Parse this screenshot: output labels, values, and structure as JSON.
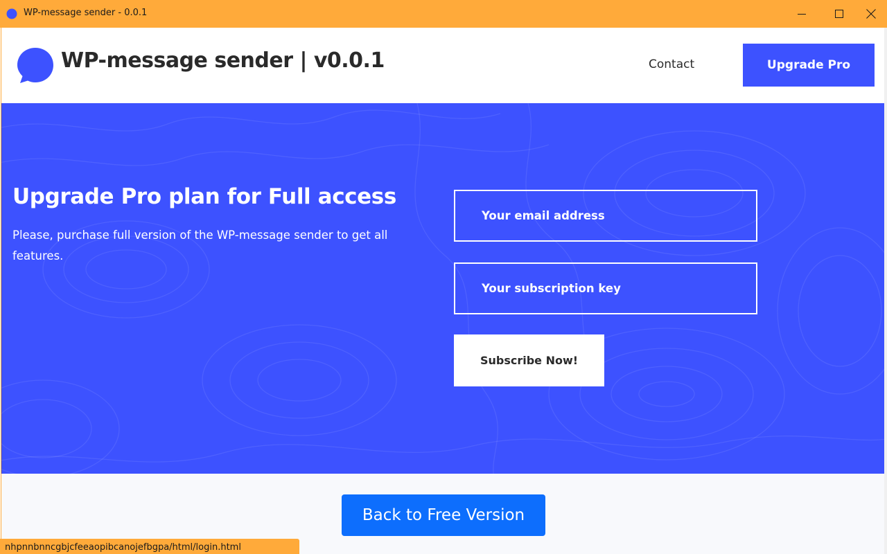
{
  "window": {
    "title": "WP-message sender - 0.0.1",
    "accent_color": "#ffaa3a"
  },
  "header": {
    "brand": "WP-message sender | v0.0.1",
    "logo_icon": "chat-bubble-icon",
    "nav_contact": "Contact",
    "upgrade_button": "Upgrade Pro",
    "brand_color": "#3d52ff"
  },
  "hero": {
    "title": "Upgrade Pro plan for Full access",
    "description": "Please, purchase full version of the WP-message sender to get all features.",
    "email_placeholder": "Your email address",
    "key_placeholder": "Your subscription key",
    "subscribe_button": "Subscribe Now!",
    "background_color": "#3d52ff"
  },
  "footer": {
    "back_button": "Back to Free Version",
    "back_button_color": "#0d6efd"
  },
  "statusbar": {
    "url": "nhpnnbnncgbjcfeeaopibcanojefbgpa/html/login.html"
  }
}
